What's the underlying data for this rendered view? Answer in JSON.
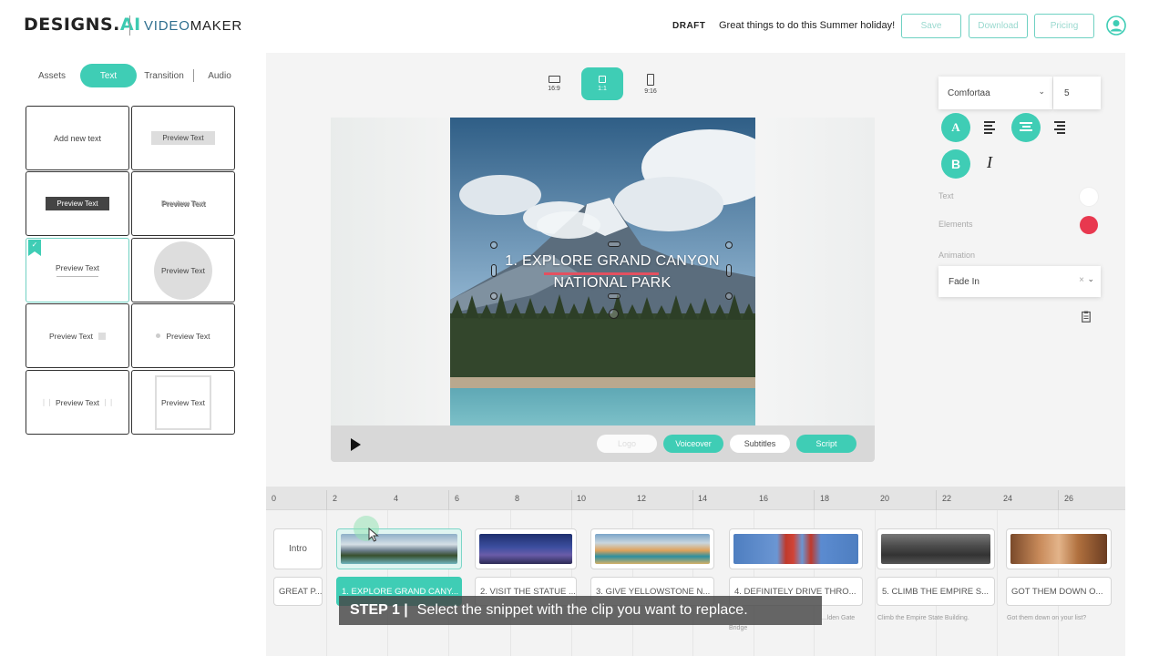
{
  "header": {
    "logo_text": "DESIGNS.",
    "logo_ai": "AI",
    "product_prefix": "VIDEO",
    "product_suffix": "MAKER",
    "draft_label": "DRAFT",
    "project_title": "Great things to do this Summer holiday!",
    "save_label": "Save",
    "download_label": "Download",
    "pricing_label": "Pricing",
    "profile_icon": "user-circle-icon"
  },
  "sidebar": {
    "tabs": [
      {
        "label": "Assets",
        "active": false
      },
      {
        "label": "Text",
        "active": true
      },
      {
        "label": "Transition",
        "active": false
      },
      {
        "label": "Audio",
        "active": false
      }
    ],
    "cards": [
      {
        "label": "Add new text",
        "style": "plain"
      },
      {
        "label": "Preview Text",
        "style": "gray-box"
      },
      {
        "label": "Preview Text",
        "style": "dark-box"
      },
      {
        "label": "Preview Text",
        "style": "shadow"
      },
      {
        "label": "Preview Text",
        "style": "underline",
        "selected": true
      },
      {
        "label": "Preview Text",
        "style": "circle"
      },
      {
        "label": "Preview Text",
        "style": "square-right"
      },
      {
        "label": "Preview Text",
        "style": "dot-left"
      },
      {
        "label": "Preview Text",
        "style": "quotes"
      },
      {
        "label": "Preview Text",
        "style": "frame"
      }
    ]
  },
  "canvas": {
    "ratios": [
      {
        "label": "16:9",
        "active": false
      },
      {
        "label": "1:1",
        "active": true
      },
      {
        "label": "9:16",
        "active": false
      }
    ],
    "overlay_line1": "1. EXPLORE GRAND CANYON",
    "overlay_line2": "NATIONAL PARK",
    "player": {
      "play_icon": "play-icon",
      "logo_label": "Logo",
      "voiceover_label": "Voiceover",
      "subtitles_label": "Subtitles",
      "script_label": "Script"
    }
  },
  "properties": {
    "font": "Comfortaa",
    "font_size": "5",
    "text_label": "Text",
    "elements_label": "Elements",
    "animation_label": "Animation",
    "animation_value": "Fade In",
    "colors": {
      "accent": "#3fcdb5",
      "text_color": "#ffffff",
      "elements_color": "#e8384f"
    }
  },
  "timeline": {
    "ticks": [
      "0",
      "2",
      "4",
      "6",
      "8",
      "10",
      "12",
      "14",
      "16",
      "18",
      "20",
      "22",
      "24",
      "26"
    ],
    "intro_label": "Intro",
    "intro_text": "GREAT P...",
    "clips": [
      {
        "text": "1. EXPLORE GRAND CANY...",
        "subtitle": "",
        "selected": true
      },
      {
        "text": "2. VISIT THE STATUE ...",
        "subtitle": ""
      },
      {
        "text": "3. GIVE YELLOWSTONE N...",
        "subtitle": ""
      },
      {
        "text": "4. DEFINITELY DRIVE THRO...",
        "subtitle": "Bridge"
      },
      {
        "text": "5. CLIMB THE EMPIRE S...",
        "subtitle": "Climb the Empire State Building."
      },
      {
        "text": "GOT THEM DOWN O...",
        "subtitle": "Got them down on your list?"
      }
    ],
    "extra_subtitle": "...lden Gate"
  },
  "caption": {
    "step": "STEP 1 |",
    "text": "Select the snippet with the clip you want to replace."
  }
}
